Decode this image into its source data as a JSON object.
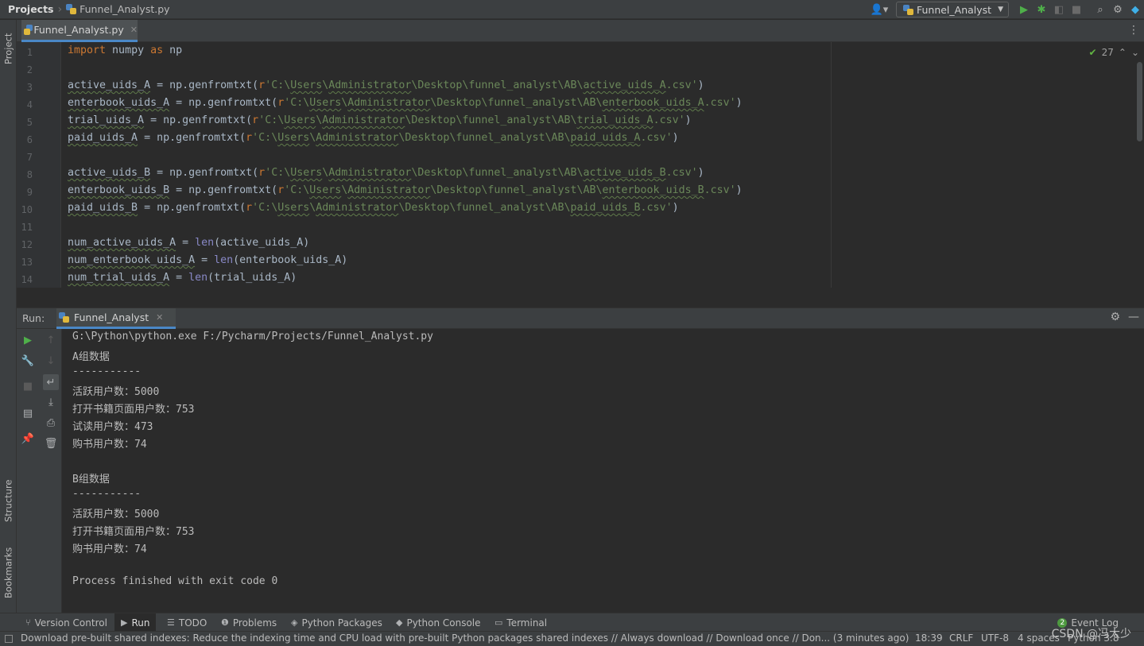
{
  "navbar": {
    "project": "Projects",
    "file": "Funnel_Analyst.py",
    "run_config": "Funnel_Analyst"
  },
  "left_strip": {
    "project": "Project",
    "structure": "Structure",
    "bookmarks": "Bookmarks"
  },
  "editor": {
    "tab": "Funnel_Analyst.py",
    "inspection_count": "27",
    "line_numbers": [
      "1",
      "2",
      "3",
      "4",
      "5",
      "6",
      "7",
      "8",
      "9",
      "10",
      "11",
      "12",
      "13",
      "14"
    ],
    "lines": [
      "import numpy as np",
      "",
      "active_uids_A = np.genfromtxt(r'C:\\Users\\Administrator\\Desktop\\funnel_analyst\\AB\\active_uids_A.csv')",
      "enterbook_uids_A = np.genfromtxt(r'C:\\Users\\Administrator\\Desktop\\funnel_analyst\\AB\\enterbook_uids_A.csv')",
      "trial_uids_A = np.genfromtxt(r'C:\\Users\\Administrator\\Desktop\\funnel_analyst\\AB\\trial_uids_A.csv')",
      "paid_uids_A = np.genfromtxt(r'C:\\Users\\Administrator\\Desktop\\funnel_analyst\\AB\\paid_uids_A.csv')",
      "",
      "active_uids_B = np.genfromtxt(r'C:\\Users\\Administrator\\Desktop\\funnel_analyst\\AB\\active_uids_B.csv')",
      "enterbook_uids_B = np.genfromtxt(r'C:\\Users\\Administrator\\Desktop\\funnel_analyst\\AB\\enterbook_uids_B.csv')",
      "paid_uids_B = np.genfromtxt(r'C:\\Users\\Administrator\\Desktop\\funnel_analyst\\AB\\paid_uids_B.csv')",
      "",
      "num_active_uids_A = len(active_uids_A)",
      "num_enterbook_uids_A = len(enterbook_uids_A)",
      "num_trial_uids_A = len(trial_uids_A)"
    ]
  },
  "run": {
    "label": "Run:",
    "tab": "Funnel_Analyst",
    "console": [
      "G:\\Python\\python.exe F:/Pycharm/Projects/Funnel_Analyst.py",
      "A组数据",
      "-----------",
      "活跃用户数：5000",
      "打开书籍页面用户数：753",
      "试读用户数：473",
      "购书用户数：74",
      "",
      "B组数据",
      "-----------",
      "活跃用户数：5000",
      "打开书籍页面用户数：753",
      "购书用户数：74",
      "",
      "Process finished with exit code 0"
    ]
  },
  "bottom_tabs": {
    "version_control": "Version Control",
    "run": "Run",
    "todo": "TODO",
    "problems": "Problems",
    "python_packages": "Python Packages",
    "python_console": "Python Console",
    "terminal": "Terminal",
    "event_log": "Event Log",
    "event_count": "2"
  },
  "status_bar": {
    "message": "Download pre-built shared indexes: Reduce the indexing time and CPU load with pre-built Python packages shared indexes // Always download // Download once // Don... (3 minutes ago)",
    "position": "18:39",
    "line_sep": "CRLF",
    "encoding": "UTF-8",
    "indent": "4 spaces",
    "interpreter": "Python 3.8"
  },
  "watermark": "CSDN @冯大少"
}
